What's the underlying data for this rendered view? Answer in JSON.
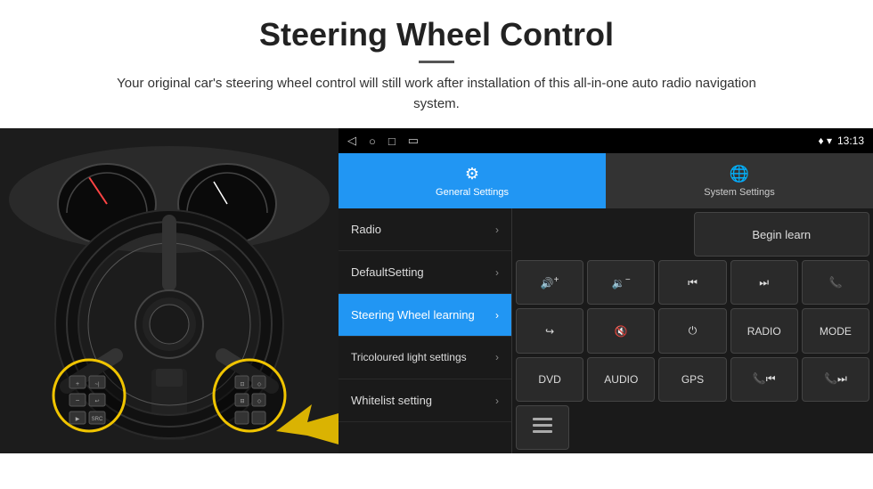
{
  "header": {
    "title": "Steering Wheel Control",
    "subtitle": "Your original car's steering wheel control will still work after installation of this all-in-one auto radio navigation system."
  },
  "status_bar": {
    "nav_back": "◁",
    "nav_home": "○",
    "nav_recent": "□",
    "nav_extra": "▭",
    "signal_icon": "♦",
    "wifi_icon": "▾",
    "time": "13:13"
  },
  "tabs": [
    {
      "id": "general",
      "icon": "⚙",
      "label": "General Settings",
      "active": true
    },
    {
      "id": "system",
      "icon": "🌐",
      "label": "System Settings",
      "active": false
    }
  ],
  "menu_items": [
    {
      "id": "radio",
      "label": "Radio",
      "active": false
    },
    {
      "id": "default",
      "label": "DefaultSetting",
      "active": false
    },
    {
      "id": "steering",
      "label": "Steering Wheel learning",
      "active": true
    },
    {
      "id": "tricoloured",
      "label": "Tricoloured light settings",
      "active": false
    },
    {
      "id": "whitelist",
      "label": "Whitelist setting",
      "active": false
    }
  ],
  "control_buttons": {
    "row1": [
      {
        "id": "empty1",
        "label": "",
        "empty": true
      },
      {
        "id": "begin-learn",
        "label": "Begin learn",
        "special": true
      }
    ],
    "row2": [
      {
        "id": "vol-up",
        "label": "🔊+",
        "icon": true
      },
      {
        "id": "vol-down",
        "label": "🔉−",
        "icon": true
      },
      {
        "id": "prev-track",
        "label": "⏮",
        "icon": true
      },
      {
        "id": "next-track",
        "label": "⏭",
        "icon": true
      },
      {
        "id": "phone",
        "label": "📞",
        "icon": true
      }
    ],
    "row3": [
      {
        "id": "hang-up",
        "label": "↩",
        "icon": true
      },
      {
        "id": "mute",
        "label": "🔇x",
        "icon": true
      },
      {
        "id": "power",
        "label": "⏻",
        "icon": true
      },
      {
        "id": "radio-btn",
        "label": "RADIO",
        "icon": false
      },
      {
        "id": "mode",
        "label": "MODE",
        "icon": false
      }
    ],
    "row4": [
      {
        "id": "dvd",
        "label": "DVD",
        "icon": false
      },
      {
        "id": "audio",
        "label": "AUDIO",
        "icon": false
      },
      {
        "id": "gps",
        "label": "GPS",
        "icon": false
      },
      {
        "id": "tel-prev",
        "label": "📞⏮",
        "icon": true
      },
      {
        "id": "tel-next",
        "label": "📞⏭",
        "icon": true
      }
    ],
    "row5": [
      {
        "id": "list-icon",
        "label": "≡",
        "icon": true
      }
    ]
  }
}
